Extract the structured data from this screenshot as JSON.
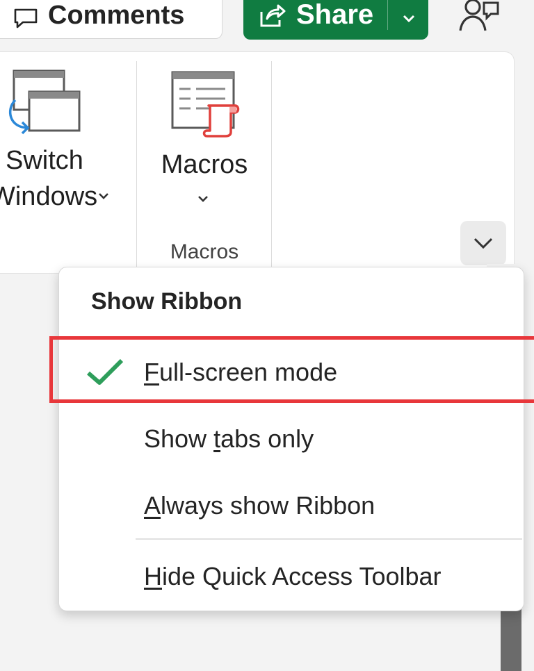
{
  "topbar": {
    "comments_label": "Comments",
    "share_label": "Share"
  },
  "ribbon": {
    "switch_windows": {
      "line1": "Switch",
      "line2": "Windows"
    },
    "macros": {
      "label": "Macros",
      "group_label": "Macros"
    }
  },
  "menu": {
    "header": "Show Ribbon",
    "items": [
      {
        "access_key": "F",
        "rest": "ull-screen mode",
        "checked": true
      },
      {
        "pre": "Show ",
        "access_key": "t",
        "rest": "abs only"
      },
      {
        "access_key": "A",
        "rest": "lways show Ribbon"
      },
      {
        "access_key": "H",
        "rest": "ide Quick Access Toolbar"
      }
    ]
  },
  "colors": {
    "share_green": "#107c41",
    "check_green": "#2e9e5b",
    "highlight_red": "#e8373b"
  },
  "icons": [
    "comment-icon",
    "share-icon",
    "chevron-down-icon",
    "people-icon",
    "switch-windows-icon",
    "macros-icon",
    "checkmark-icon"
  ]
}
